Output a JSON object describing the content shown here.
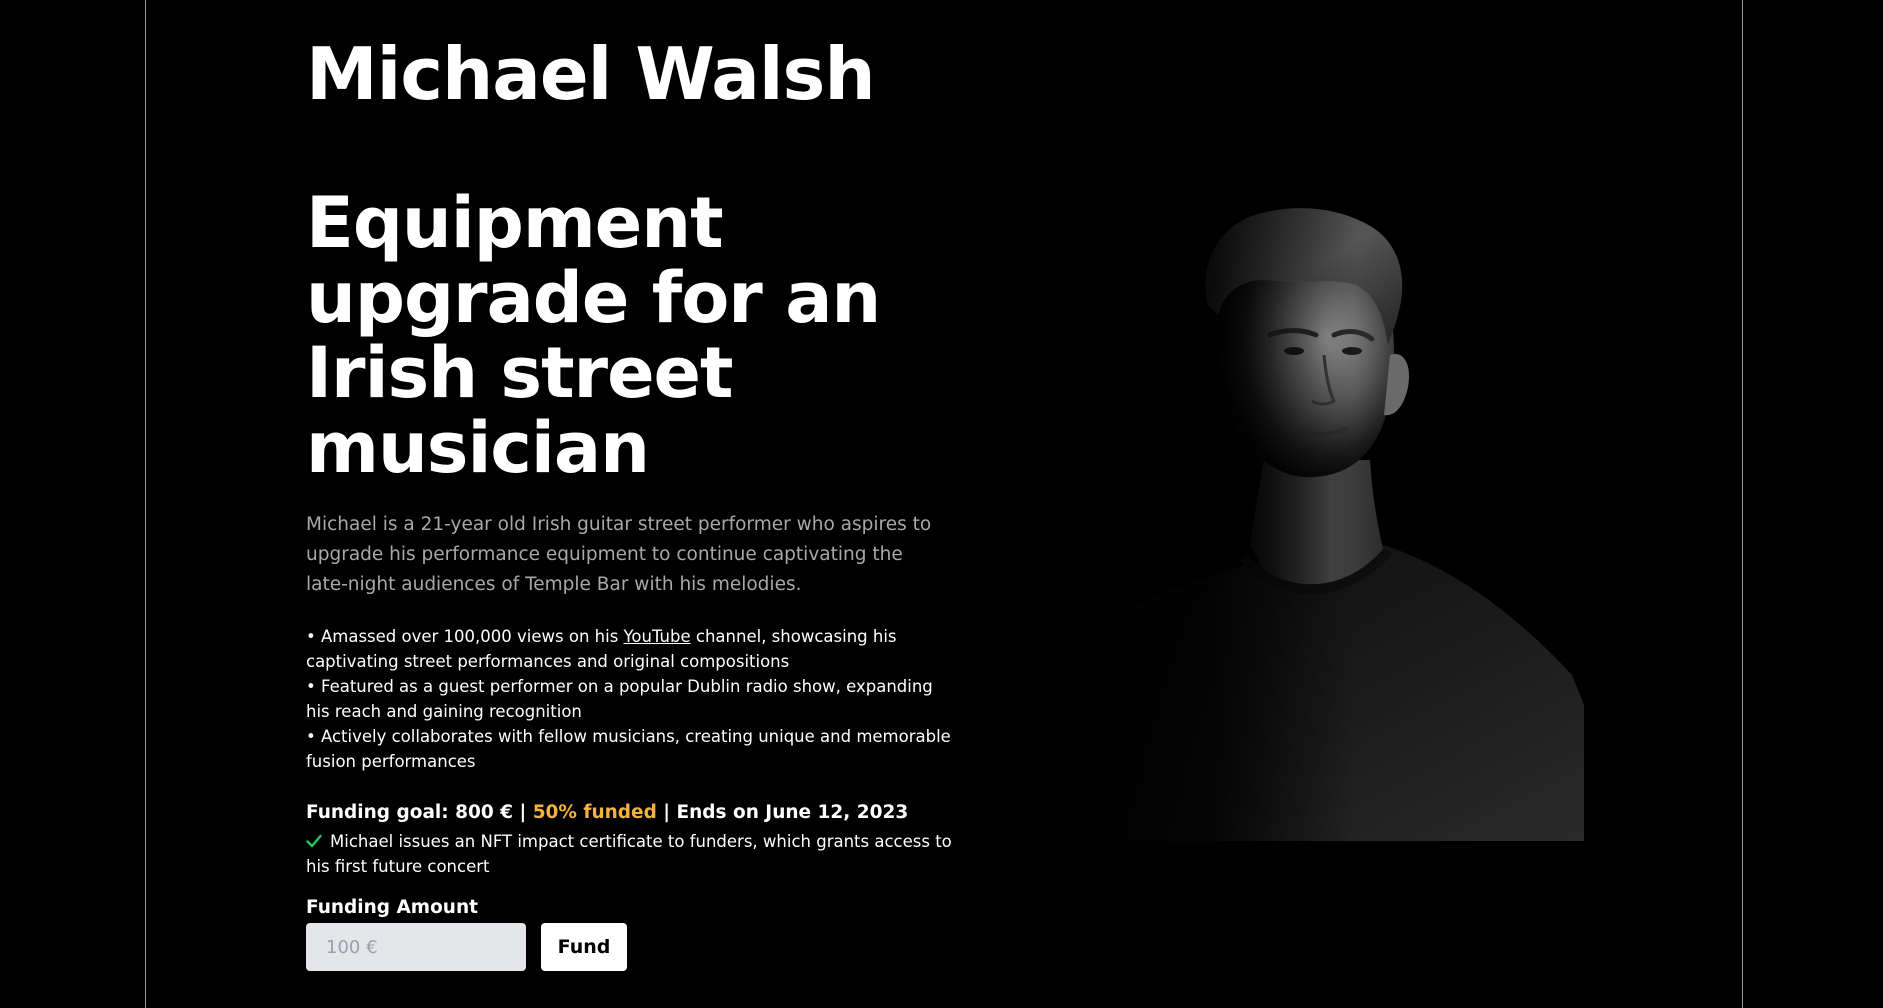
{
  "musician": {
    "name": "Michael Walsh"
  },
  "campaign": {
    "title": "Equipment upgrade for an Irish street musician",
    "description": "Michael is a 21-year old Irish guitar street performer who aspires to upgrade his performance equipment to continue captivating the late-night audiences of Temple Bar with his melodies.",
    "highlights": [
      {
        "prefix": "• Amassed over 100,000 views on his ",
        "link_text": "YouTube",
        "suffix": " channel, showcasing his captivating street performances and original compositions"
      },
      {
        "text": "• Featured as a guest performer on a popular Dublin radio show, expanding his reach and gaining recognition"
      },
      {
        "text": "• Actively collaborates with fellow musicians, creating unique and memorable fusion performances"
      }
    ]
  },
  "funding": {
    "goal_text": "Funding goal: 800 €",
    "separator": " | ",
    "funded_text": "50% funded",
    "funded_fraction": 0.5,
    "ends_text": "Ends on June 12, 2023",
    "nft_text": "Michael issues an NFT impact certificate to funders, which grants access to his first future concert",
    "amount_label": "Funding Amount",
    "amount_placeholder": "100 €",
    "fund_button_label": "Fund"
  },
  "colors": {
    "background": "#000000",
    "accent_funded": "#f2b33d",
    "check": "#22c55e"
  },
  "icons": {
    "check": "check-icon"
  }
}
